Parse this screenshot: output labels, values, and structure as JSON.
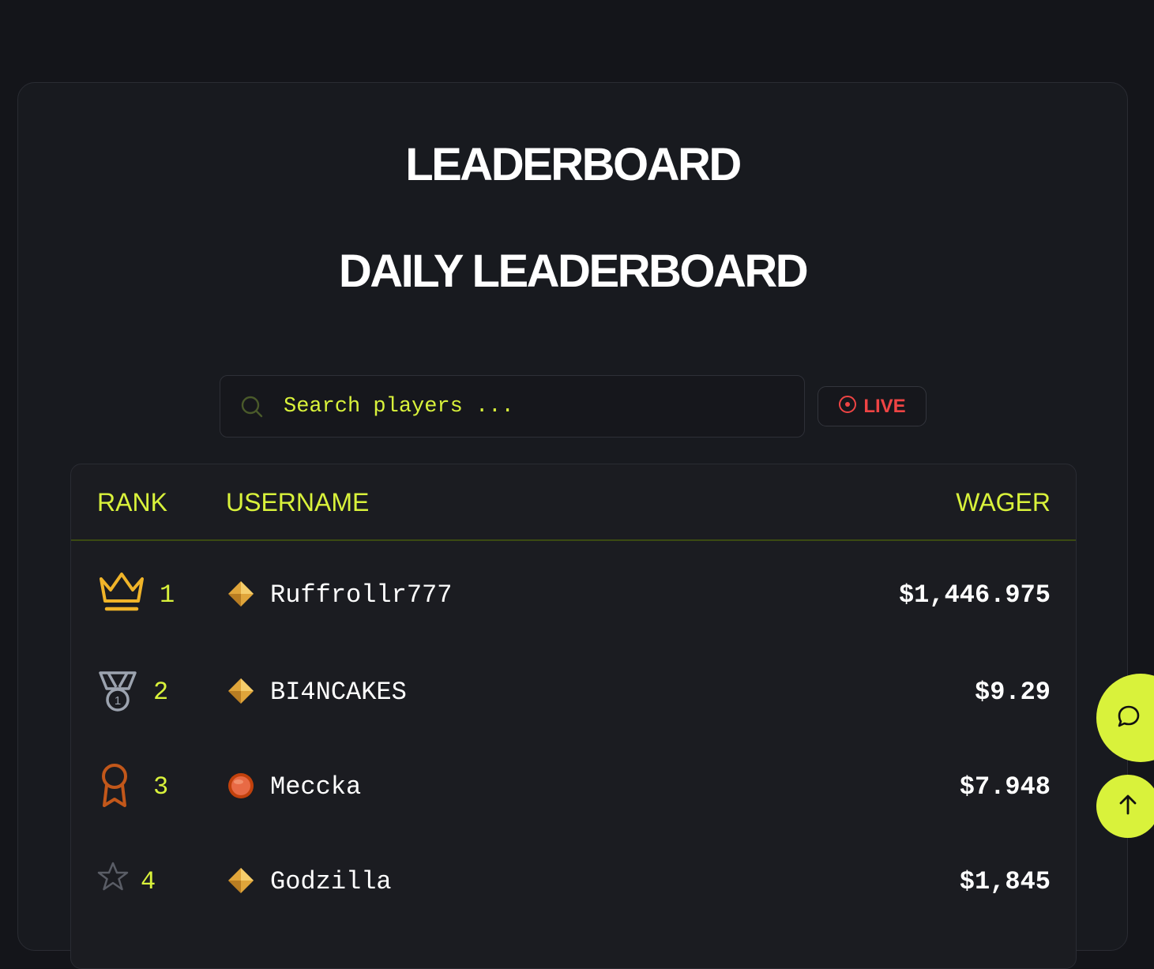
{
  "page": {
    "title": "LEADERBOARD",
    "subtitle": "DAILY LEADERBOARD"
  },
  "search": {
    "placeholder": "Search players ...",
    "value": "",
    "icon": "search-icon"
  },
  "live_badge": {
    "label": "LIVE",
    "icon": "live-dot-icon",
    "color": "#ef4444"
  },
  "table": {
    "headers": {
      "rank": "RANK",
      "username": "USERNAME",
      "wager": "WAGER"
    },
    "rows": [
      {
        "rank": "1",
        "rank_icon": "crown-icon",
        "tier_icon": "gold-diamond-icon",
        "username": "Ruffrollr777",
        "wager": "$1,446.975"
      },
      {
        "rank": "2",
        "rank_icon": "silver-medal-icon",
        "tier_icon": "gold-diamond-icon",
        "username": "BI4NCAKES",
        "wager": "$9.29"
      },
      {
        "rank": "3",
        "rank_icon": "bronze-award-icon",
        "tier_icon": "bronze-orb-icon",
        "username": "Meccka",
        "wager": "$7.948"
      },
      {
        "rank": "4",
        "rank_icon": "star-icon",
        "tier_icon": "gold-diamond-icon",
        "username": "Godzilla",
        "wager": "$1,845"
      }
    ]
  },
  "floating": {
    "chat_icon": "chat-bubble-icon",
    "scroll_top_icon": "arrow-up-icon"
  },
  "colors": {
    "accent": "#d9f23b",
    "background": "#14151a",
    "live": "#ef4444",
    "gold": "#f0b429",
    "silver": "#9ca3af",
    "bronze": "#c2571a"
  }
}
